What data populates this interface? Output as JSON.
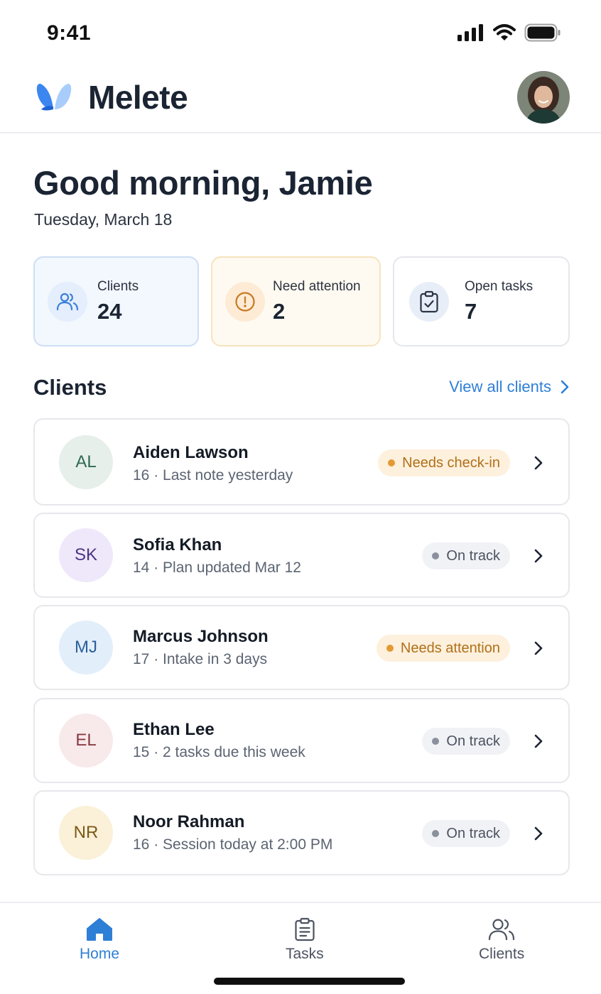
{
  "status_bar": {
    "time": "9:41"
  },
  "header": {
    "app_name": "Melete"
  },
  "greeting": {
    "title": "Good morning, Jamie",
    "date": "Tuesday, March 18"
  },
  "stats": [
    {
      "label": "Clients",
      "value": "24",
      "icon": "users-icon"
    },
    {
      "label": "Need attention",
      "value": "2",
      "icon": "alert-circle-icon"
    },
    {
      "label": "Open tasks",
      "value": "7",
      "icon": "clipboard-check-icon"
    }
  ],
  "clients_section": {
    "title": "Clients",
    "view_all_label": "View all clients"
  },
  "clients": [
    {
      "initials": "AL",
      "name": "Aiden Lawson",
      "meta": "16 · Last note yesterday",
      "status": "Needs check-in",
      "status_kind": "warn"
    },
    {
      "initials": "SK",
      "name": "Sofia Khan",
      "meta": "14 · Plan updated Mar 12",
      "status": "On track",
      "status_kind": "ok"
    },
    {
      "initials": "MJ",
      "name": "Marcus Johnson",
      "meta": "17 · Intake in 3 days",
      "status": "Needs attention",
      "status_kind": "warn"
    },
    {
      "initials": "EL",
      "name": "Ethan Lee",
      "meta": "15 · 2 tasks due this week",
      "status": "On track",
      "status_kind": "ok"
    },
    {
      "initials": "NR",
      "name": "Noor Rahman",
      "meta": "16 · Session today at 2:00 PM",
      "status": "On track",
      "status_kind": "ok"
    }
  ],
  "bottom_nav": [
    {
      "label": "Home",
      "icon": "home-icon",
      "active": true
    },
    {
      "label": "Tasks",
      "icon": "clipboard-icon",
      "active": false
    },
    {
      "label": "Clients",
      "icon": "users-icon",
      "active": false
    }
  ],
  "colors": {
    "accent": "#2e7fd6",
    "warning": "#e39a34",
    "text": "#1b2433"
  }
}
